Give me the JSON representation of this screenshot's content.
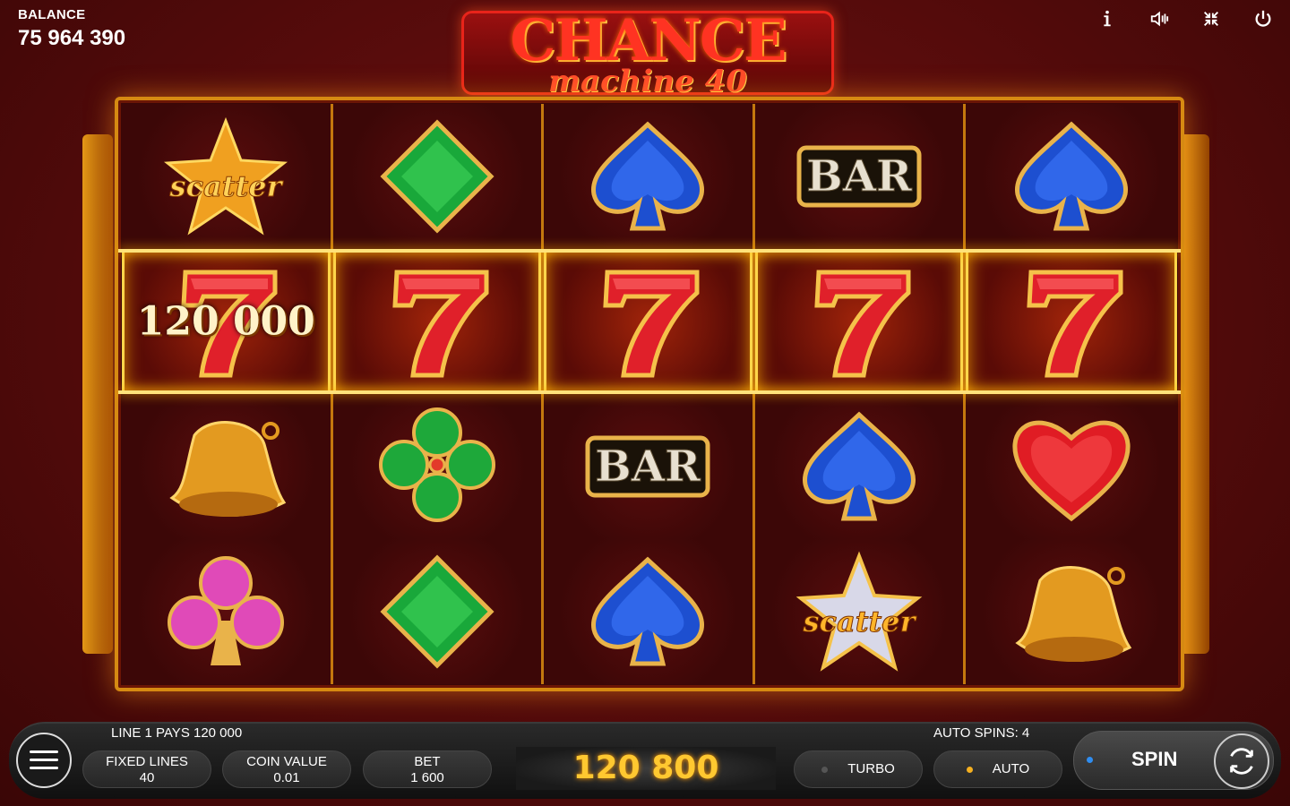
{
  "header": {
    "balance_label": "BALANCE",
    "balance_value": "75 964 390",
    "icons": [
      "info-icon",
      "sound-icon",
      "fullscreen-icon",
      "power-icon"
    ]
  },
  "logo": {
    "line1": "CHANCE",
    "line2": "machine 40"
  },
  "reels": {
    "rows": [
      [
        "scatter-gold",
        "diamond-green",
        "spade-blue",
        "bar",
        "spade-blue"
      ],
      [
        "seven-red",
        "seven-red",
        "seven-red",
        "seven-red",
        "seven-red"
      ],
      [
        "bell-gold",
        "clover-green",
        "bar",
        "spade-blue",
        "heart-red"
      ],
      [
        "club-pink",
        "diamond-green",
        "spade-blue",
        "scatter-silver",
        "bell-gold"
      ]
    ],
    "win_row": 1,
    "win_amount": "120 000",
    "bar_text": "BAR",
    "scatter_text": "scatter"
  },
  "bottom_bar": {
    "line_info": "LINE 1 PAYS 120 000",
    "auto_spins": "AUTO SPINS: 4",
    "fixed_lines_label": "FIXED LINES",
    "fixed_lines_value": "40",
    "coin_value_label": "COIN VALUE",
    "coin_value_value": "0.01",
    "bet_label": "BET",
    "bet_value": "1 600",
    "win_display": "120 800",
    "turbo_label": "TURBO",
    "auto_label": "AUTO",
    "spin_label": "SPIN"
  },
  "colors": {
    "accent_gold": "#d68a12",
    "win_text": "#ffc830",
    "auto_dot": "#f5b020",
    "spin_dot": "#2f8df0",
    "turbo_dot": "#555555"
  }
}
